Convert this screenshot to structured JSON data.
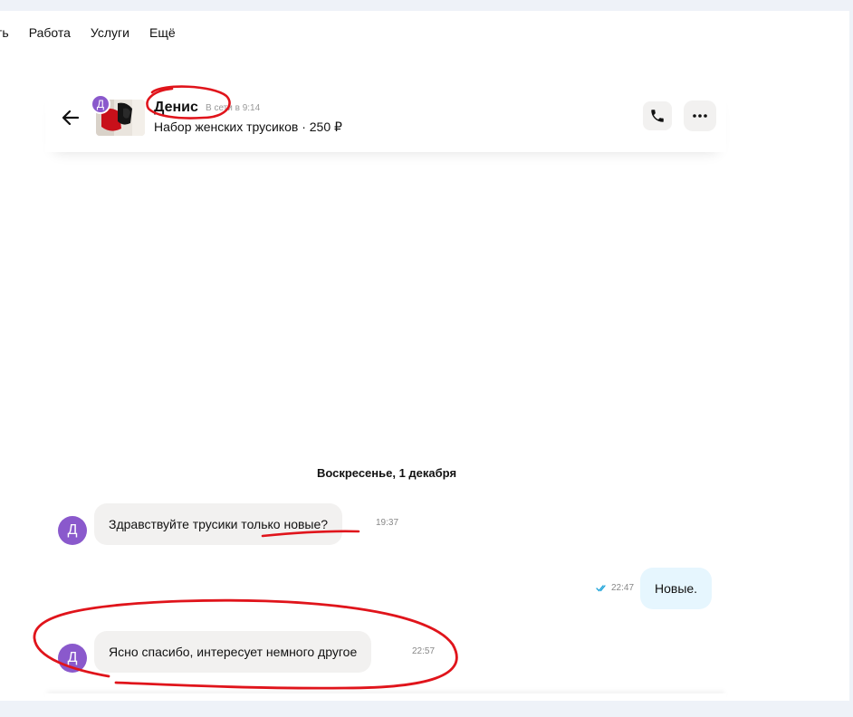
{
  "nav": {
    "items": [
      "ть",
      "Работа",
      "Услуги",
      "Ещё"
    ]
  },
  "chat": {
    "contact_initial": "Д",
    "contact_name": "Денис",
    "status": "В сети в 9:14",
    "item_title": "Набор женских трусиков · 250 ₽",
    "date_separator": "Воскресенье, 1 декабря",
    "messages": [
      {
        "direction": "in",
        "text": "Здравствуйте трусики только новые?",
        "time": "19:37"
      },
      {
        "direction": "out",
        "text": "Новые.",
        "time": "22:47",
        "read": true
      },
      {
        "direction": "in",
        "text": "Ясно спасибо, интересует немного другое",
        "time": "22:57"
      }
    ]
  },
  "colors": {
    "avatar": "#8a59cc",
    "incoming_bubble": "#f2f1f0",
    "outgoing_bubble": "#e6f6fe",
    "read_check": "#1aa2d9",
    "annotation": "#e0141b"
  },
  "icons": {
    "back": "arrow-left-icon",
    "phone": "phone-icon",
    "more": "more-horizontal-icon",
    "read": "double-check-icon"
  }
}
